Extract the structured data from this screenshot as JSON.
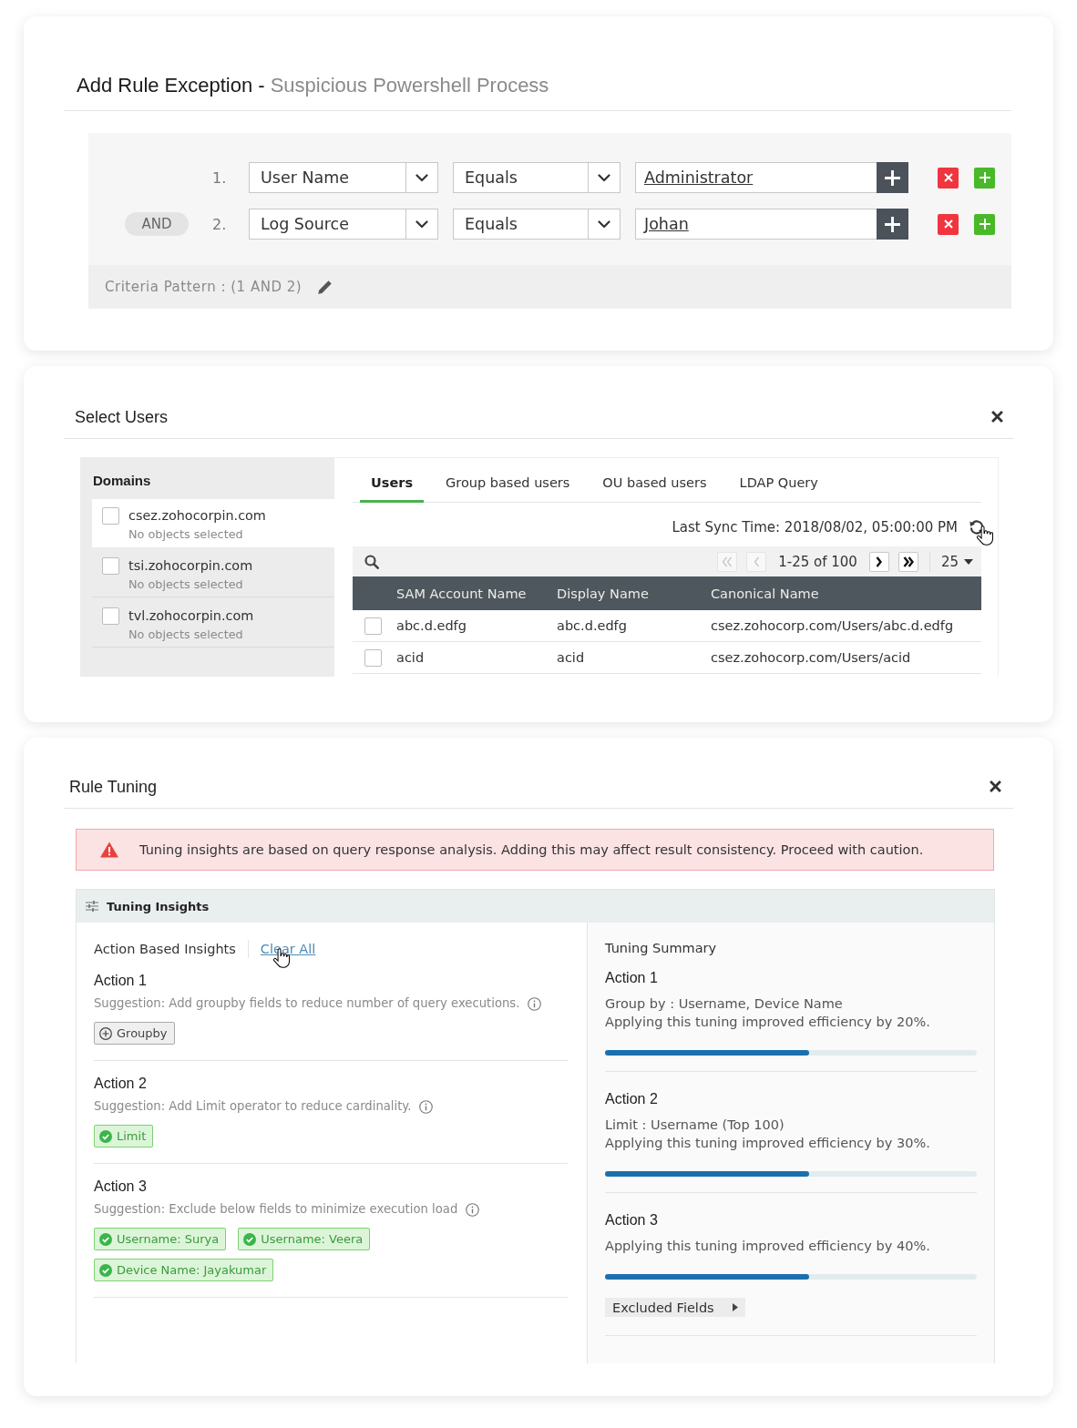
{
  "rule_exception": {
    "title": "Add Rule Exception -",
    "subtitle": "Suspicious Powershell Process",
    "criteria": [
      {
        "number": "1.",
        "field": "User Name",
        "operator": "Equals",
        "value": "Administrator"
      },
      {
        "connector": "AND",
        "number": "2.",
        "field": "Log Source",
        "operator": "Equals",
        "value": "Johan"
      }
    ],
    "pattern": "Criteria Pattern : (1 AND 2)"
  },
  "select_users": {
    "title": "Select Users",
    "domains_heading": "Domains",
    "domains": [
      {
        "name": "csez.zohocorpin.com",
        "status": "No objects selected",
        "checked": false,
        "selected": true
      },
      {
        "name": "tsi.zohocorpin.com",
        "status": "No objects selected",
        "checked": false,
        "selected": false
      },
      {
        "name": "tvl.zohocorpin.com",
        "status": "No objects selected",
        "checked": false,
        "selected": false
      }
    ],
    "tabs": [
      {
        "label": "Users",
        "selected": true
      },
      {
        "label": "Group based users",
        "selected": false
      },
      {
        "label": "OU based users",
        "selected": false
      },
      {
        "label": "LDAP Query",
        "selected": false
      }
    ],
    "last_sync": "Last Sync Time: 2018/08/02, 05:00:00 PM",
    "pagination": {
      "buttons": [
        {
          "kind": "first",
          "disabled": true
        },
        {
          "kind": "previous",
          "disabled": true
        },
        {
          "kind": "next",
          "disabled": false
        },
        {
          "kind": "last",
          "disabled": false
        }
      ],
      "range": "1-25 of 100",
      "page_size": "25"
    },
    "table": {
      "columns": [
        "SAM Account Name",
        "Display Name",
        "Canonical Name"
      ],
      "rows": [
        {
          "checked": false,
          "cells": [
            "abc.d.edfg",
            "abc.d.edfg",
            "csez.zohocorp.com/Users/abc.d.edfg"
          ]
        },
        {
          "checked": false,
          "cells": [
            "acid",
            "acid",
            "csez.zohocorp.com/Users/acid"
          ]
        }
      ]
    }
  },
  "rule_tuning": {
    "title": "Rule Tuning",
    "alert": "Tuning insights are based on query response analysis. Adding this may affect result consistency. Proceed with caution.",
    "insights": {
      "title": "Tuning Insights",
      "heading": "Action Based Insights",
      "clear_all": "Clear All",
      "actions": [
        {
          "title": "Action 1",
          "suggestion": "Suggestion: Add groupby fields to reduce number of query executions.",
          "chips": [
            {
              "label": "Groupby",
              "selected": false
            }
          ]
        },
        {
          "title": "Action 2",
          "suggestion": "Suggestion: Add Limit operator to reduce cardinality.",
          "chips": [
            {
              "label": "Limit",
              "selected": true
            }
          ]
        },
        {
          "title": "Action 3",
          "suggestion": "Suggestion: Exclude below fields to minimize execution load",
          "chips": [
            {
              "label": "Username: Surya",
              "selected": true
            },
            {
              "label": "Username: Veera",
              "selected": true
            },
            {
              "label": "Device Name: Jayakumar",
              "selected": true
            }
          ]
        }
      ]
    },
    "summary": {
      "heading": "Tuning Summary",
      "actions": [
        {
          "title": "Action 1",
          "lines": [
            "Group by : Username, Device Name",
            "Applying this tuning improved efficiency by 20%."
          ],
          "level": 0.55
        },
        {
          "title": "Action 2",
          "lines": [
            "Limit : Username (Top 100)",
            "Applying this tuning improved efficiency by 30%."
          ],
          "level": 0.55
        },
        {
          "title": "Action 3",
          "lines": [
            "Applying this tuning improved efficiency by 40%."
          ],
          "level": 0.55,
          "expander": "Excluded Fields"
        }
      ]
    }
  }
}
